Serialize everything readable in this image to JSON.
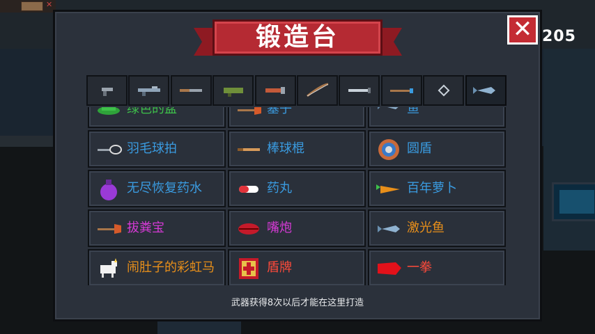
{
  "hud": {
    "counter": "205"
  },
  "panel": {
    "title": "锻造台",
    "close_label": "✕",
    "footer": "武器获得8次以后才能在这里打造"
  },
  "tabs": [
    {
      "icon": "pistol-icon",
      "active": false
    },
    {
      "icon": "rifle-icon",
      "active": false
    },
    {
      "icon": "shotgun-icon",
      "active": false
    },
    {
      "icon": "launcher-icon",
      "active": false
    },
    {
      "icon": "blaster-icon",
      "active": false
    },
    {
      "icon": "bow-icon",
      "active": false
    },
    {
      "icon": "sword-icon",
      "active": false
    },
    {
      "icon": "staff-icon",
      "active": false
    },
    {
      "icon": "crosshair-icon",
      "active": false
    },
    {
      "icon": "fish-icon",
      "active": true
    }
  ],
  "items": [
    [
      {
        "name": "绿色的盆",
        "color": "#3ec24a",
        "icon": "green-basin-icon"
      },
      {
        "name": "塞子",
        "color": "#3a9be0",
        "icon": "plunger-icon"
      },
      {
        "name": "鱼",
        "color": "#3a9be0",
        "icon": "fish-icon"
      }
    ],
    [
      {
        "name": "羽毛球拍",
        "color": "#3a9be0",
        "icon": "badminton-racket-icon"
      },
      {
        "name": "棒球棍",
        "color": "#3a9be0",
        "icon": "baseball-bat-icon"
      },
      {
        "name": "圆盾",
        "color": "#3a9be0",
        "icon": "round-shield-icon"
      }
    ],
    [
      {
        "name": "无尽恢复药水",
        "color": "#3a9be0",
        "icon": "potion-icon"
      },
      {
        "name": "药丸",
        "color": "#3a9be0",
        "icon": "pill-icon"
      },
      {
        "name": "百年萝卜",
        "color": "#3a9be0",
        "icon": "carrot-icon"
      }
    ],
    [
      {
        "name": "拔粪宝",
        "color": "#d63ad6",
        "icon": "plunger-icon"
      },
      {
        "name": "嘴炮",
        "color": "#d63ad6",
        "icon": "lips-icon"
      },
      {
        "name": "激光鱼",
        "color": "#e88f1a",
        "icon": "laser-fish-icon"
      }
    ],
    [
      {
        "name": "闹肚子的彩虹马",
        "color": "#e88f1a",
        "icon": "unicorn-icon"
      },
      {
        "name": "盾牌",
        "color": "#ff4a3a",
        "icon": "shield-icon"
      },
      {
        "name": "一拳",
        "color": "#ff4a3a",
        "icon": "red-glove-icon"
      }
    ]
  ]
}
